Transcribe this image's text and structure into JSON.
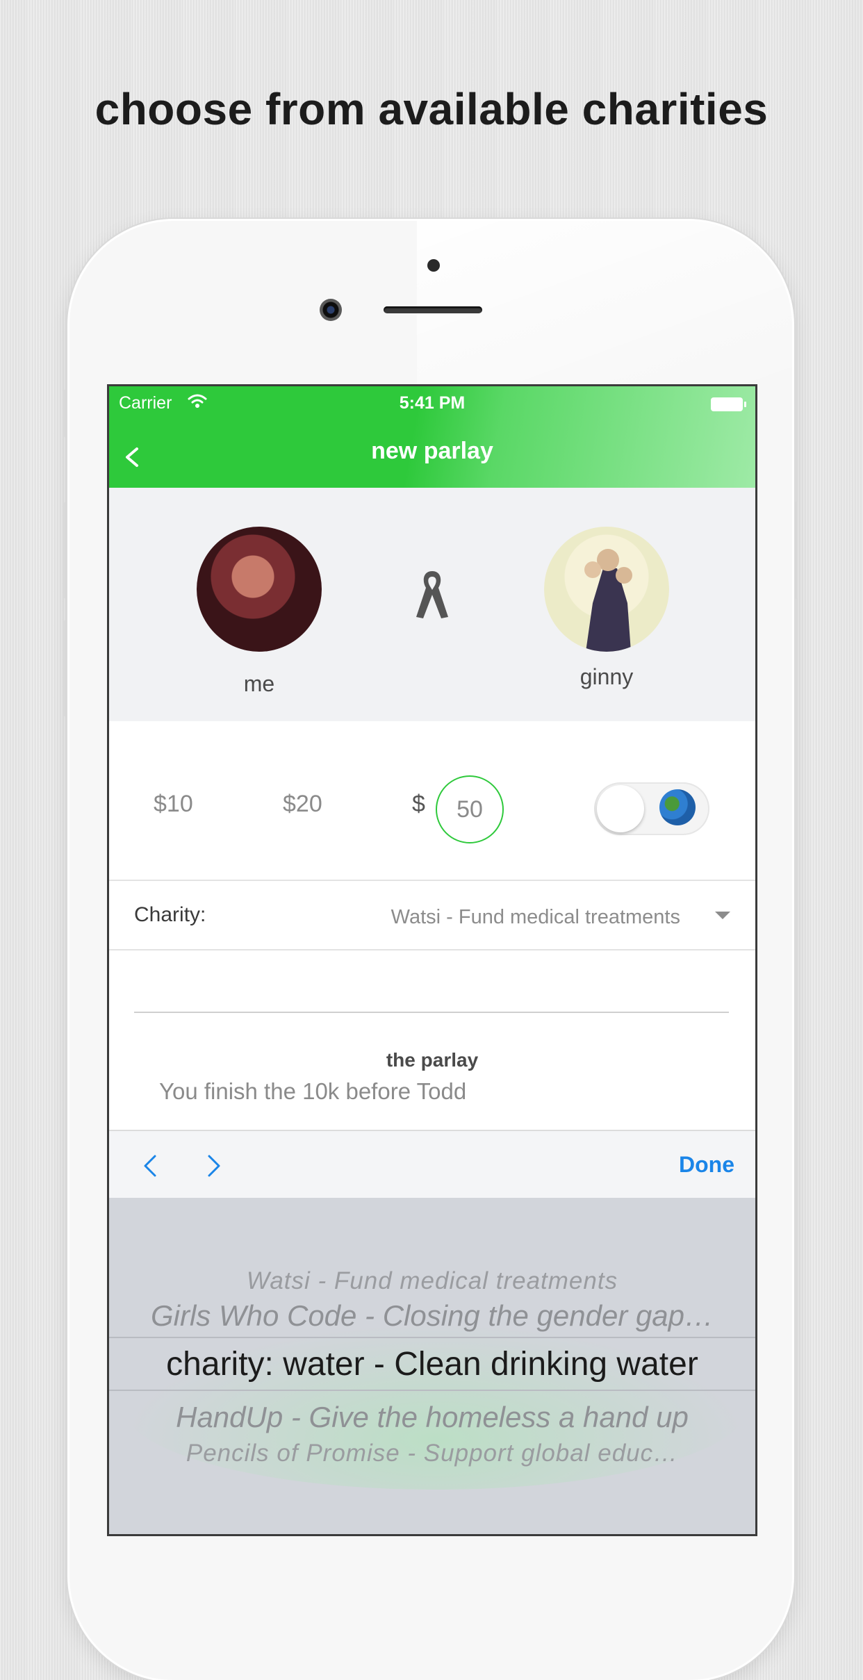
{
  "headline": "choose from available charities",
  "status_bar": {
    "carrier": "Carrier",
    "time": "5:41 PM"
  },
  "nav": {
    "title": "new parlay"
  },
  "players": {
    "left_name": "me",
    "right_name": "ginny"
  },
  "amounts": {
    "option1": "$10",
    "option2": "$20",
    "dollar_sign": "$",
    "selected_value": "50"
  },
  "toggle": {
    "state": "off",
    "icon": "globe-icon"
  },
  "charity": {
    "label": "Charity:",
    "value": "Watsi - Fund medical treatments"
  },
  "parlay": {
    "heading": "the parlay",
    "text": "You finish the 10k before Todd"
  },
  "toolbar": {
    "done_label": "Done"
  },
  "picker": {
    "items": [
      "Watsi - Fund medical treatments",
      "Girls Who Code - Closing the gender gap…",
      "charity: water - Clean drinking water",
      "HandUp - Give the homeless a hand up",
      "Pencils of Promise - Support global educ…"
    ],
    "selected_index": 2
  },
  "colors": {
    "accent_green": "#2ec93b",
    "link_blue": "#1a85e8"
  }
}
